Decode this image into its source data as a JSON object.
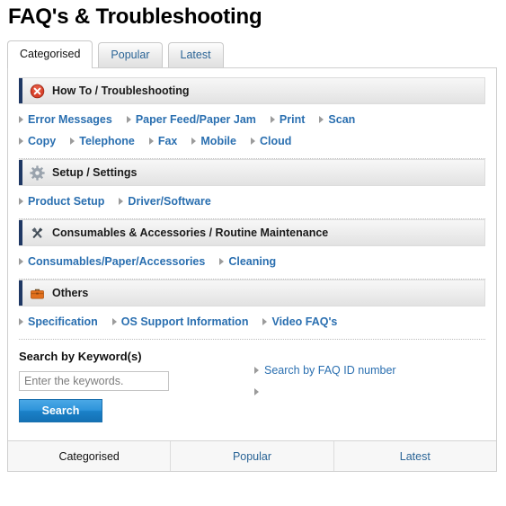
{
  "page": {
    "title": "FAQ's & Troubleshooting"
  },
  "tabs": [
    {
      "label": "Categorised",
      "active": true
    },
    {
      "label": "Popular",
      "active": false
    },
    {
      "label": "Latest",
      "active": false
    }
  ],
  "categories": [
    {
      "title": "How To / Troubleshooting",
      "icon": "error-circle-icon",
      "icon_color": "#d8402a",
      "link_rows": [
        [
          "Error Messages",
          "Paper Feed/Paper Jam",
          "Print",
          "Scan"
        ],
        [
          "Copy",
          "Telephone",
          "Fax",
          "Mobile",
          "Cloud"
        ]
      ]
    },
    {
      "title": "Setup / Settings",
      "icon": "gear-icon",
      "icon_color": "#9aa3ad",
      "link_rows": [
        [
          "Product Setup",
          "Driver/Software"
        ]
      ]
    },
    {
      "title": "Consumables & Accessories / Routine Maintenance",
      "icon": "tools-icon",
      "icon_color": "#56606b",
      "link_rows": [
        [
          "Consumables/Paper/Accessories",
          "Cleaning"
        ]
      ]
    },
    {
      "title": "Others",
      "icon": "briefcase-icon",
      "icon_color": "#e2701e",
      "link_rows": [
        [
          "Specification",
          "OS Support Information",
          "Video FAQ's"
        ]
      ]
    }
  ],
  "search": {
    "label": "Search by Keyword(s)",
    "input_value": "",
    "placeholder": "Enter the keywords.",
    "button_label": "Search",
    "side_links": [
      "Search by FAQ ID number",
      ""
    ]
  },
  "bottom_tabs": [
    {
      "label": "Categorised",
      "active": true
    },
    {
      "label": "Popular",
      "active": false
    },
    {
      "label": "Latest",
      "active": false
    }
  ],
  "colors": {
    "accent_bar": "#1f3864",
    "link": "#2a6fb0",
    "button": "#1b81c8"
  }
}
